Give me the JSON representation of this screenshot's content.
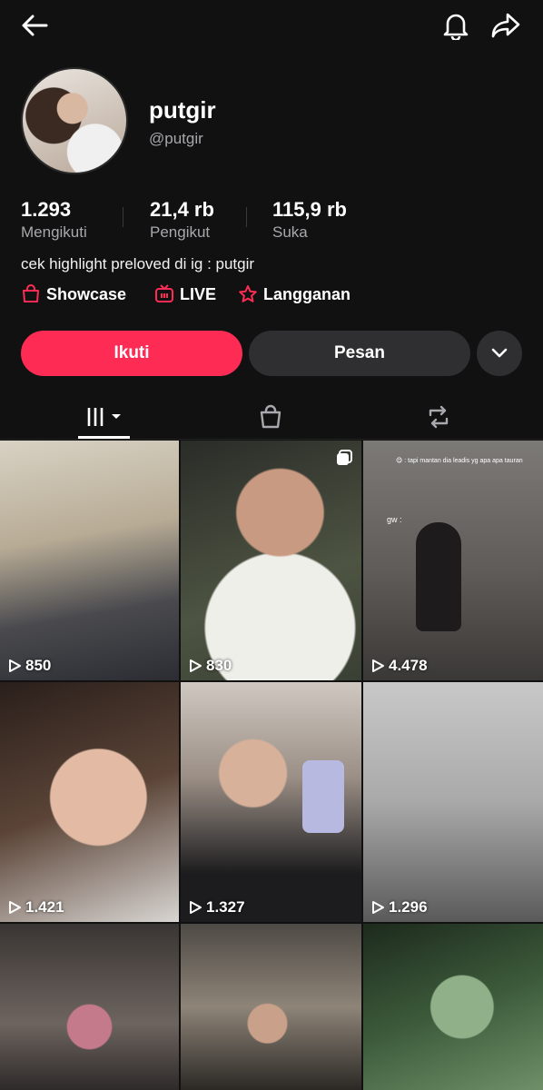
{
  "header": {
    "back": "back-arrow-icon",
    "bell": "bell-icon",
    "share": "share-icon"
  },
  "profile": {
    "name": "putgir",
    "handle": "@putgir",
    "bio": "cek highlight preloved di ig : putgir"
  },
  "stats": [
    {
      "value": "1.293",
      "label": "Mengikuti"
    },
    {
      "value": "21,4 rb",
      "label": "Pengikut"
    },
    {
      "value": "115,9 rb",
      "label": "Suka"
    }
  ],
  "links": [
    {
      "label": "Showcase",
      "icon": "shopping-bag-icon"
    },
    {
      "label": "LIVE",
      "icon": "tv-icon"
    },
    {
      "label": "Langganan",
      "icon": "star-badge-icon"
    }
  ],
  "actions": {
    "follow": "Ikuti",
    "message": "Pesan"
  },
  "tabs": [
    "grid-icon",
    "shopping-bag-icon",
    "repost-icon"
  ],
  "colors": {
    "accent": "#fe2c55",
    "background": "#111112",
    "secondary_button": "#2f2f31"
  },
  "videos": [
    {
      "views": "850"
    },
    {
      "views": "830"
    },
    {
      "views": "4.478",
      "caption_top": "😋 : tapi mantan dia leadis yg apa apa tauran",
      "caption_side": "gw :"
    },
    {
      "views": "1.421"
    },
    {
      "views": "1.327"
    },
    {
      "views": "1.296"
    },
    {
      "views": ""
    },
    {
      "views": ""
    },
    {
      "views": ""
    }
  ]
}
